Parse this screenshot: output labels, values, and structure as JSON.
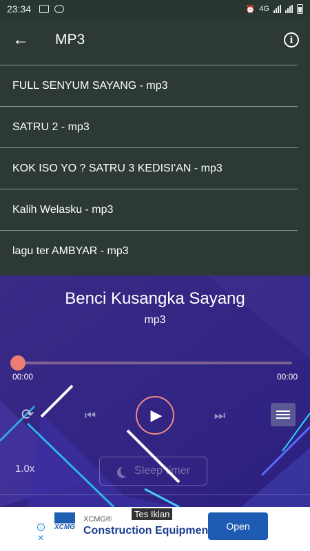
{
  "statusbar": {
    "time": "23:34",
    "network": "4G"
  },
  "appbar": {
    "title": "MP3",
    "back_icon": "arrow-left-icon",
    "info_icon": "info-icon"
  },
  "list": {
    "items": [
      {
        "label": "FULL SENYUM SAYANG - mp3"
      },
      {
        "label": "SATRU 2 - mp3"
      },
      {
        "label": "KOK ISO YO ? SATRU 3 KEDISI'AN - mp3"
      },
      {
        "label": "Kalih Welasku - mp3"
      },
      {
        "label": "lagu ter AMBYAR - mp3"
      }
    ]
  },
  "player": {
    "song_title": "Benci Kusangka Sayang",
    "song_subtitle": "mp3",
    "elapsed": "00:00",
    "duration": "00:00",
    "progress": 0,
    "speed": "1.0x",
    "sleep_timer_label": "Sleep timer",
    "colors": {
      "accent": "#f07d74",
      "background": "#2a1e70"
    }
  },
  "ad": {
    "label": "Tes Iklan",
    "brand": "XCMG®",
    "logo_text": "XCMG",
    "headline": "Construction Equipment",
    "cta": "Open"
  }
}
